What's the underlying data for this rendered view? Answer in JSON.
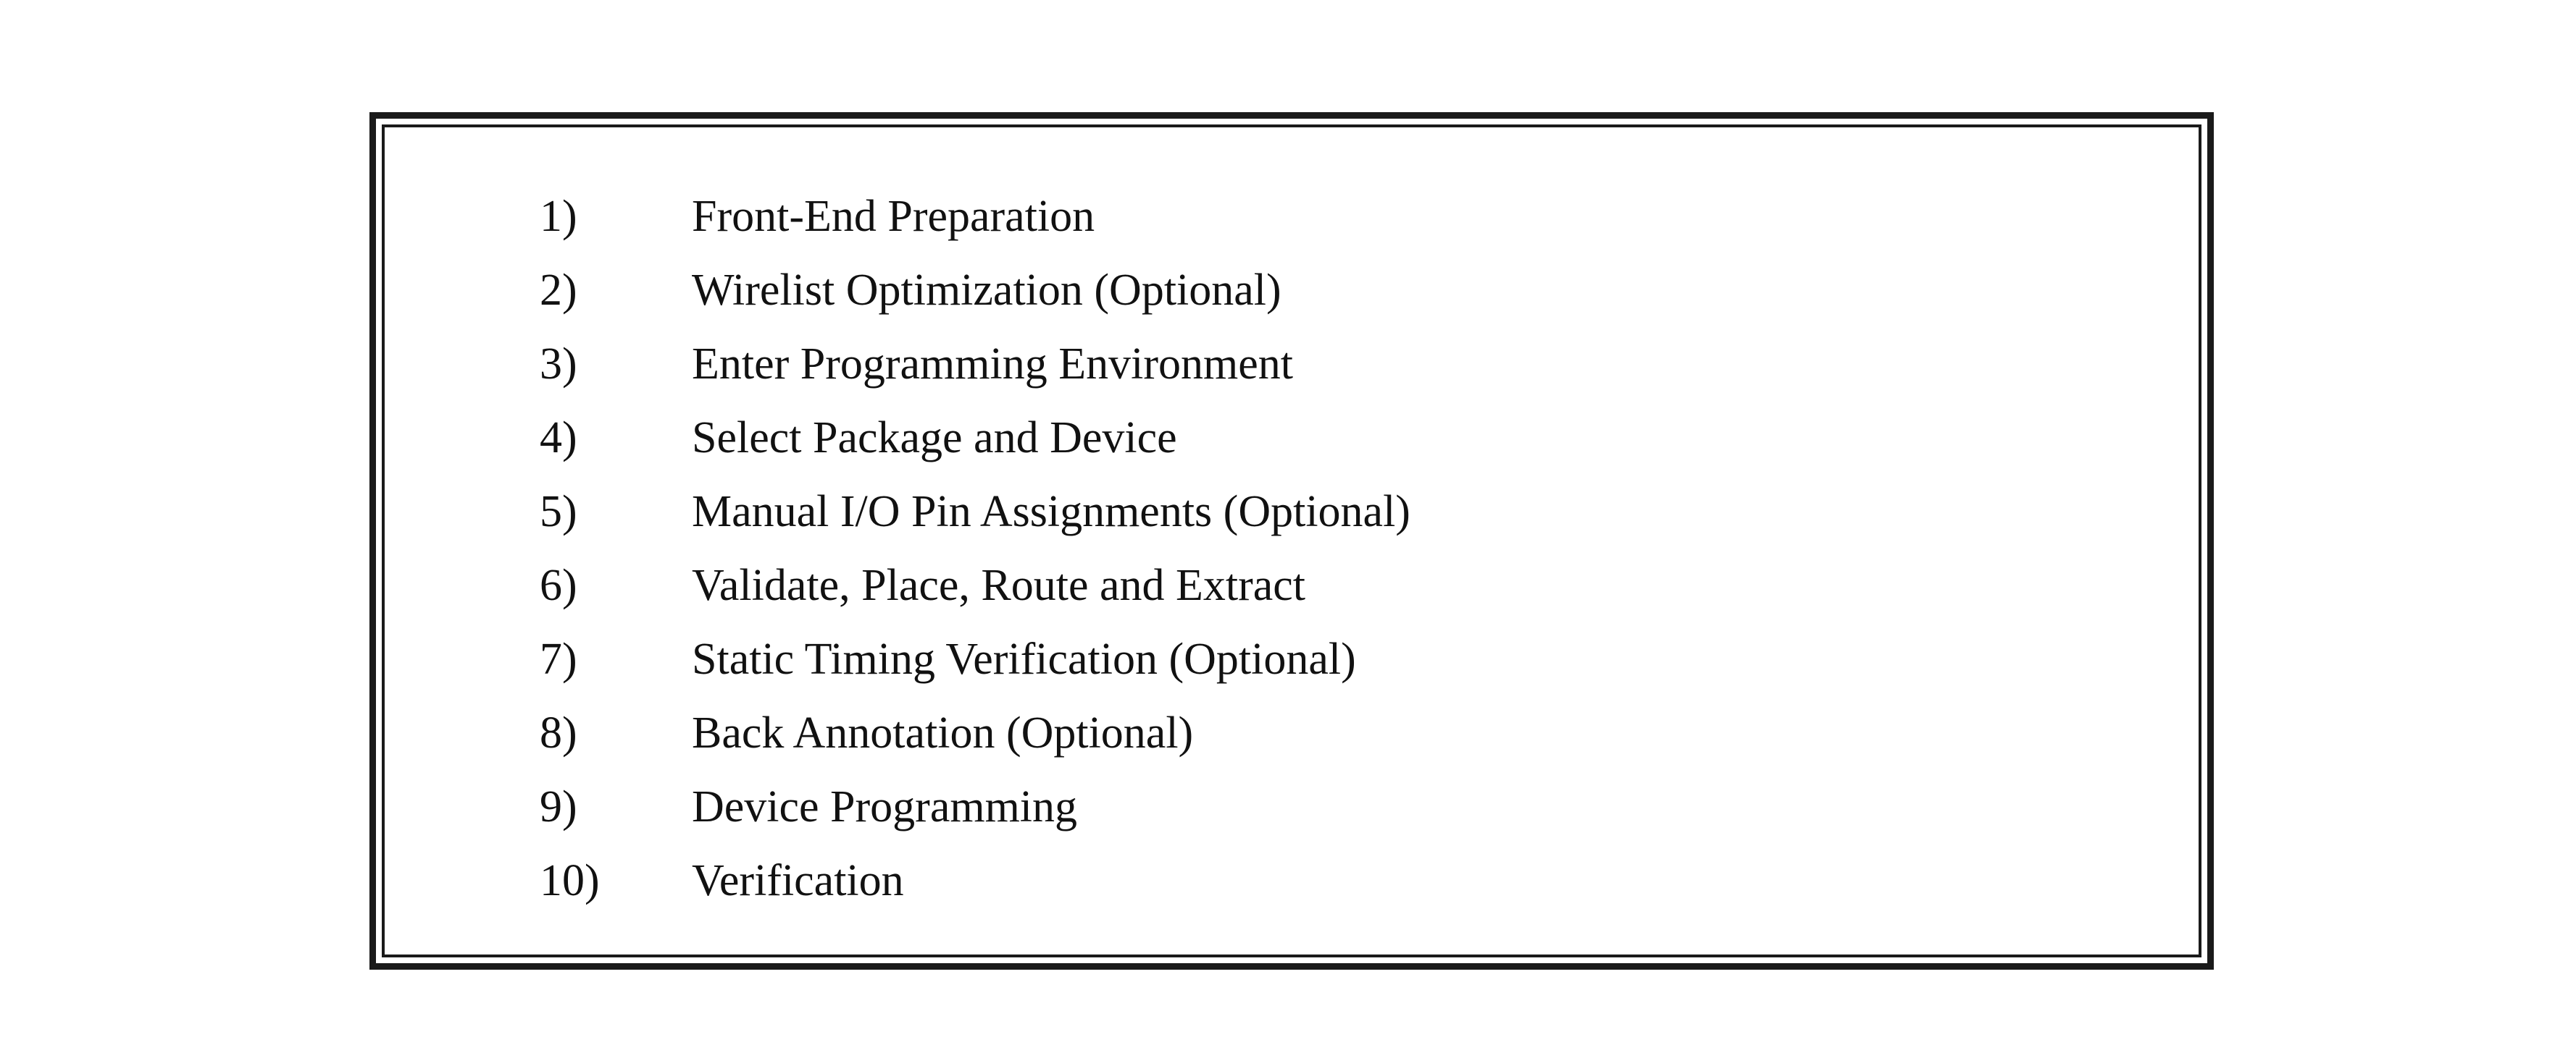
{
  "steps": [
    {
      "number": "1)",
      "text": "Front-End Preparation"
    },
    {
      "number": "2)",
      "text": "Wirelist Optimization (Optional)"
    },
    {
      "number": "3)",
      "text": "Enter Programming Environment"
    },
    {
      "number": "4)",
      "text": "Select Package and Device"
    },
    {
      "number": "5)",
      "text": "Manual I/O Pin Assignments (Optional)"
    },
    {
      "number": "6)",
      "text": "Validate, Place, Route and Extract"
    },
    {
      "number": "7)",
      "text": "Static Timing Verification (Optional)"
    },
    {
      "number": "8)",
      "text": "Back Annotation (Optional)"
    },
    {
      "number": "9)",
      "text": "Device Programming"
    },
    {
      "number": "10)",
      "text": "Verification"
    }
  ]
}
